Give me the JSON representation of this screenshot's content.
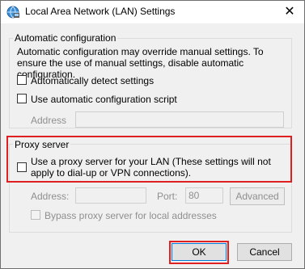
{
  "window": {
    "title": "Local Area Network (LAN) Settings",
    "close_glyph": "✕"
  },
  "auto_config": {
    "legend": "Automatic configuration",
    "description": "Automatic configuration may override manual settings.  To ensure the use of manual settings, disable automatic configuration.",
    "detect_label": "Automatically detect settings",
    "script_label": "Use automatic configuration script",
    "address_label": "Address",
    "address_value": ""
  },
  "proxy": {
    "legend": "Proxy server",
    "use_proxy_label": "Use a proxy server for your LAN (These settings will not apply to dial-up or VPN connections).",
    "address_label": "Address:",
    "address_value": "",
    "port_label": "Port:",
    "port_value": "80",
    "advanced_label": "Advanced",
    "bypass_label": "Bypass proxy server for local addresses"
  },
  "footer": {
    "ok_label": "OK",
    "cancel_label": "Cancel"
  },
  "highlight_color": "#e02020"
}
